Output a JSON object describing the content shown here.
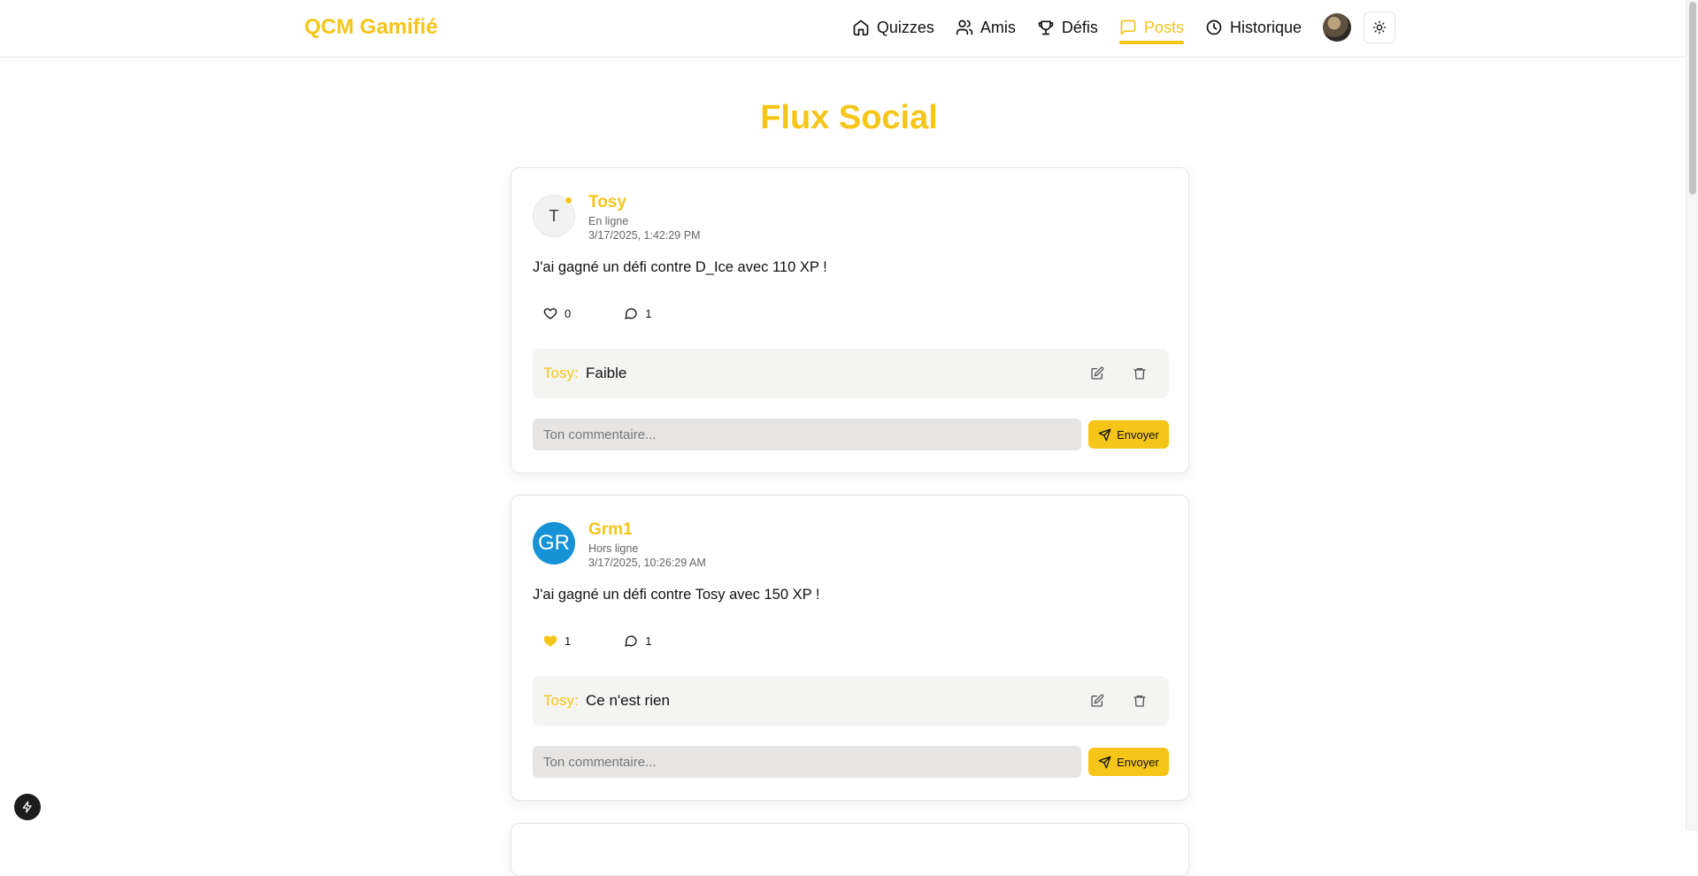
{
  "header": {
    "brand": "QCM Gamifié",
    "nav": [
      {
        "label": "Quizzes",
        "icon": "home-icon"
      },
      {
        "label": "Amis",
        "icon": "users-icon"
      },
      {
        "label": "Défis",
        "icon": "trophy-icon"
      },
      {
        "label": "Posts",
        "icon": "message-square-icon",
        "active": true
      },
      {
        "label": "Historique",
        "icon": "clock-icon"
      }
    ],
    "theme_toggle_icon": "sun-icon"
  },
  "page": {
    "title": "Flux Social"
  },
  "posts": [
    {
      "author": "Tosy",
      "avatar_letter": "T",
      "status": "En ligne",
      "timestamp": "3/17/2025, 1:42:29 PM",
      "text": "J'ai gagné un défi contre D_Ice avec 110 XP !",
      "likes": "0",
      "liked": false,
      "comments_count": "1",
      "comment": {
        "author": "Tosy:",
        "text": "Faible"
      },
      "input_placeholder": "Ton commentaire...",
      "send_label": "Envoyer"
    },
    {
      "author": "Grm1",
      "avatar_letter": "GR",
      "status": "Hors ligne",
      "timestamp": "3/17/2025, 10:26:29 AM",
      "text": "J'ai gagné un défi contre Tosy avec 150 XP !",
      "likes": "1",
      "liked": true,
      "comments_count": "1",
      "comment": {
        "author": "Tosy:",
        "text": "Ce n'est rien"
      },
      "input_placeholder": "Ton commentaire...",
      "send_label": "Envoyer"
    }
  ],
  "colors": {
    "accent": "#f5c518",
    "avatar_blue": "#1693d6",
    "comment_bg": "#f4f4f3",
    "input_bg": "#e6e5e4"
  }
}
